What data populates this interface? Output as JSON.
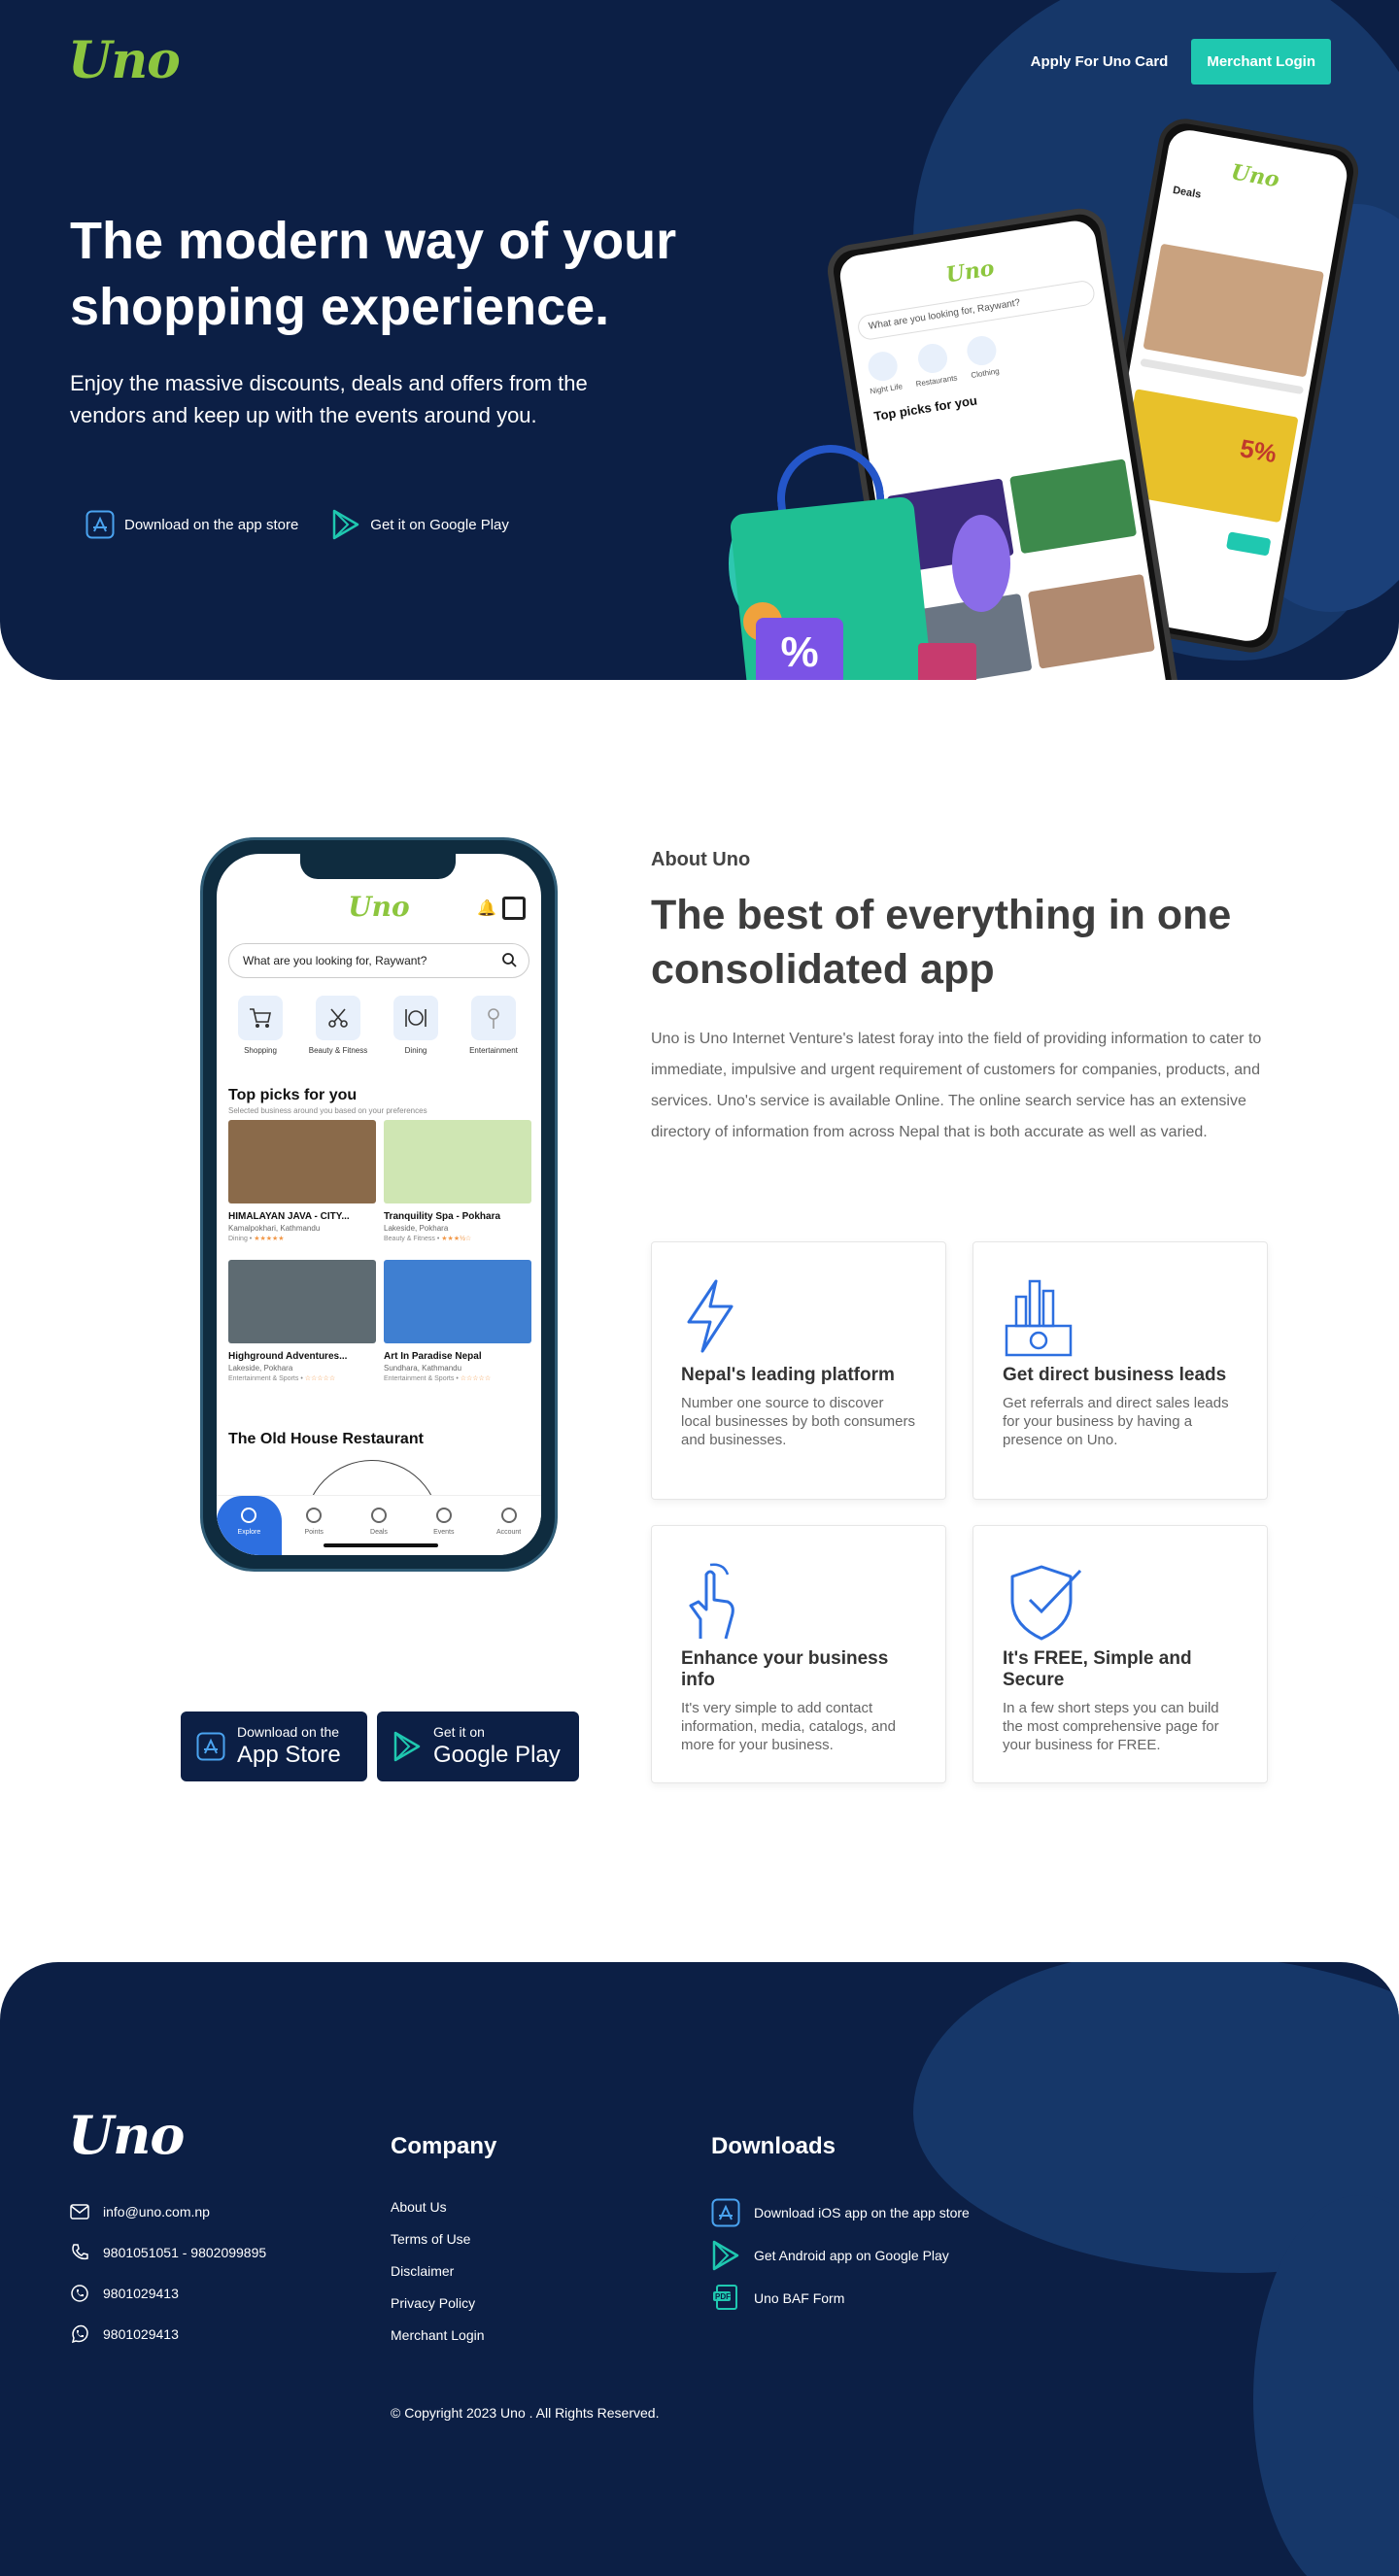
{
  "header": {
    "logo": "Uno",
    "apply_link": "Apply For Uno Card",
    "merchant_button": "Merchant Login"
  },
  "hero": {
    "title": "The modern way of your shopping experience.",
    "subtitle": " Enjoy the massive discounts, deals and offers from the vendors and keep up with the events around you.",
    "app_store_link": "Download on the app store",
    "google_play_link": "Get it on Google Play",
    "phone_back": {
      "logo": "Uno",
      "title": "Deals",
      "banner_text": "5%"
    },
    "phone_front": {
      "logo": "Uno",
      "search_placeholder": "What are you looking for, Raywant?",
      "section": "Top picks for you",
      "categories": [
        "Night Life",
        "Restaurants",
        "Clothing"
      ]
    },
    "percent_badge": "%"
  },
  "about": {
    "label": "About Uno",
    "title": "The best of everything in one consolidated app",
    "text": " Uno is Uno Internet Venture's latest foray into the field of providing information to cater to immediate, impulsive and urgent requirement of customers for companies, products, and services. Uno's service is available Online. The online search service has an extensive directory of information from across Nepal that is both accurate as well as varied.",
    "features": [
      {
        "icon": "lightning-icon",
        "title": "Nepal's leading platform",
        "desc": "Number one source to discover local businesses by both consumers and businesses."
      },
      {
        "icon": "money-chart-icon",
        "title": "Get direct business leads",
        "desc": "Get referrals and direct sales leads for your business by having a presence on Uno."
      },
      {
        "icon": "hand-touch-icon",
        "title": "Enhance your business info",
        "desc": "It's very simple to add contact information, media, catalogs, and more for your business."
      },
      {
        "icon": "shield-check-icon",
        "title": "It's FREE, Simple and Secure",
        "desc": "In a few short steps you can build the most comprehensive page for your business for FREE."
      }
    ],
    "store_buttons": {
      "apple_small": "Download on the",
      "apple_big": "App Store",
      "google_small": "Get it on",
      "google_big": "Google Play"
    }
  },
  "phone": {
    "logo": "Uno",
    "search_placeholder": "What are you looking for, Raywant?",
    "categories": [
      "Shopping",
      "Beauty & Fitness",
      "Dining",
      "Entertainment"
    ],
    "section_title": "Top picks for you",
    "section_sub": "Selected business around you based on your preferences",
    "cards": [
      {
        "title": "HIMALAYAN JAVA - CITY...",
        "location": "Kamalpokhari, Kathmandu",
        "category": "Dining",
        "rating": "★★★★★",
        "color": "#8a6a4a"
      },
      {
        "title": "Tranquility Spa -  Pokhara",
        "location": "Lakeside, Pokhara",
        "category": "Beauty & Fitness",
        "rating": "★★★½☆",
        "color": "#b9d99a"
      },
      {
        "title": "Highground Adventures...",
        "location": "Lakeside, Pokhara",
        "category": "Entertainment & Sports",
        "rating": "☆☆☆☆☆",
        "color": "#5e6b72"
      },
      {
        "title": "Art In Paradise Nepal",
        "location": "Sundhara, Kathmandu",
        "category": "Entertainment & Sports",
        "rating": "☆☆☆☆☆",
        "color": "#3f7fd1"
      }
    ],
    "restaurant": "The Old House Restaurant",
    "tabs": [
      "Explore",
      "Points",
      "Deals",
      "Events",
      "Account"
    ]
  },
  "footer": {
    "logo": "Uno",
    "email": "info@uno.com.np",
    "phone": "9801051051 - 9802099895",
    "viber": "9801029413",
    "whatsapp": "9801029413",
    "company_title": "Company",
    "company_links": [
      "About Us",
      "Terms of Use",
      "Disclaimer",
      "Privacy Policy",
      "Merchant Login"
    ],
    "downloads_title": "Downloads",
    "downloads": [
      "Download iOS app on the app store",
      "Get Android app on Google Play",
      "Uno BAF Form"
    ],
    "copyright": "© Copyright 2023 Uno . All Rights Reserved."
  },
  "colors": {
    "navy": "#0c1f45",
    "teal": "#1fc8b0",
    "brand_green": "#8dc63f",
    "icon_blue": "#2d6fe0"
  }
}
